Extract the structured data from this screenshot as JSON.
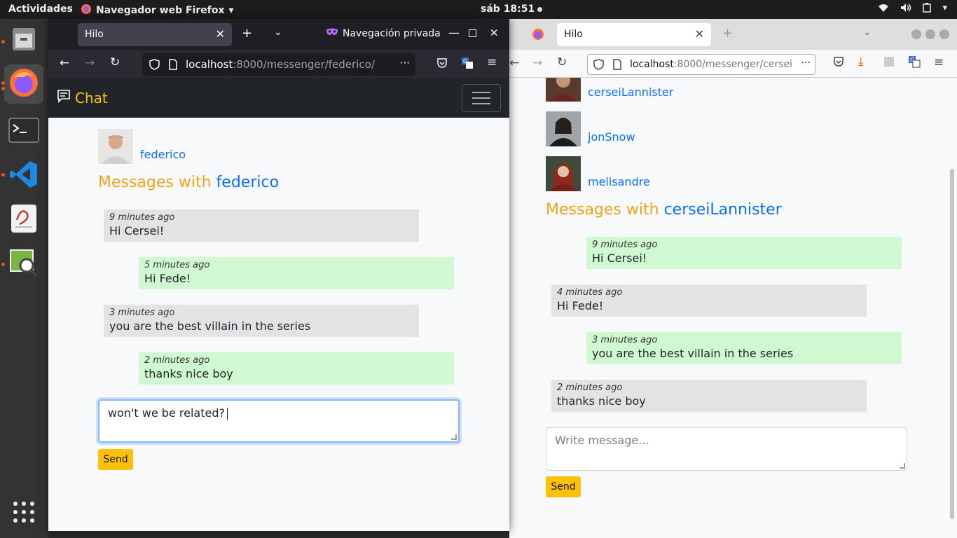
{
  "topbar": {
    "activities": "Actividades",
    "app_name": "Navegador web Firefox",
    "clock": "sáb 18:51"
  },
  "dock": {
    "items": [
      "files-icon",
      "firefox-icon",
      "terminal-icon",
      "vscode-icon",
      "text-editor-icon",
      "image-viewer-icon",
      "app-grid-icon"
    ]
  },
  "window_left": {
    "tab_title": "Hilo",
    "private_label": "Navegación privada",
    "url_host": "localhost",
    "url_path": ":8000/messenger/federico/",
    "page": {
      "brand": "Chat",
      "user_name": "federico",
      "heading_prefix": "Messages with",
      "heading_name": "federico",
      "messages": [
        {
          "time": "9 minutes ago",
          "text": "Hi Cersei!",
          "type": "recv"
        },
        {
          "time": "5 minutes ago",
          "text": "Hi Fede!",
          "type": "sent"
        },
        {
          "time": "3 minutes ago",
          "text": "you are the best villain in the series",
          "type": "recv"
        },
        {
          "time": "2 minutes ago",
          "text": "thanks nice boy",
          "type": "sent"
        }
      ],
      "input_value": "won't we be related?",
      "send_label": "Send"
    }
  },
  "window_right": {
    "tab_title": "Hilo",
    "url_host": "localhost",
    "url_path": ":8000/messenger/cersei",
    "page": {
      "users": [
        "cerseiLannister",
        "jonSnow",
        "melisandre"
      ],
      "heading_prefix": "Messages with",
      "heading_name": "cerseiLannister",
      "messages": [
        {
          "time": "9 minutes ago",
          "text": "Hi Cersei!",
          "type": "sent"
        },
        {
          "time": "4 minutes ago",
          "text": "Hi Fede!",
          "type": "recv"
        },
        {
          "time": "3 minutes ago",
          "text": "you are the best villain in the series",
          "type": "sent"
        },
        {
          "time": "2 minutes ago",
          "text": "thanks nice boy",
          "type": "recv"
        }
      ],
      "input_placeholder": "Write message...",
      "send_label": "Send"
    }
  },
  "colors": {
    "accent_yellow": "#ffc107",
    "heading_orange": "#f0a31a",
    "link_blue": "#0d6efd",
    "sent_bubble": "#d1f9d1",
    "recv_bubble": "#e2e3e5"
  }
}
